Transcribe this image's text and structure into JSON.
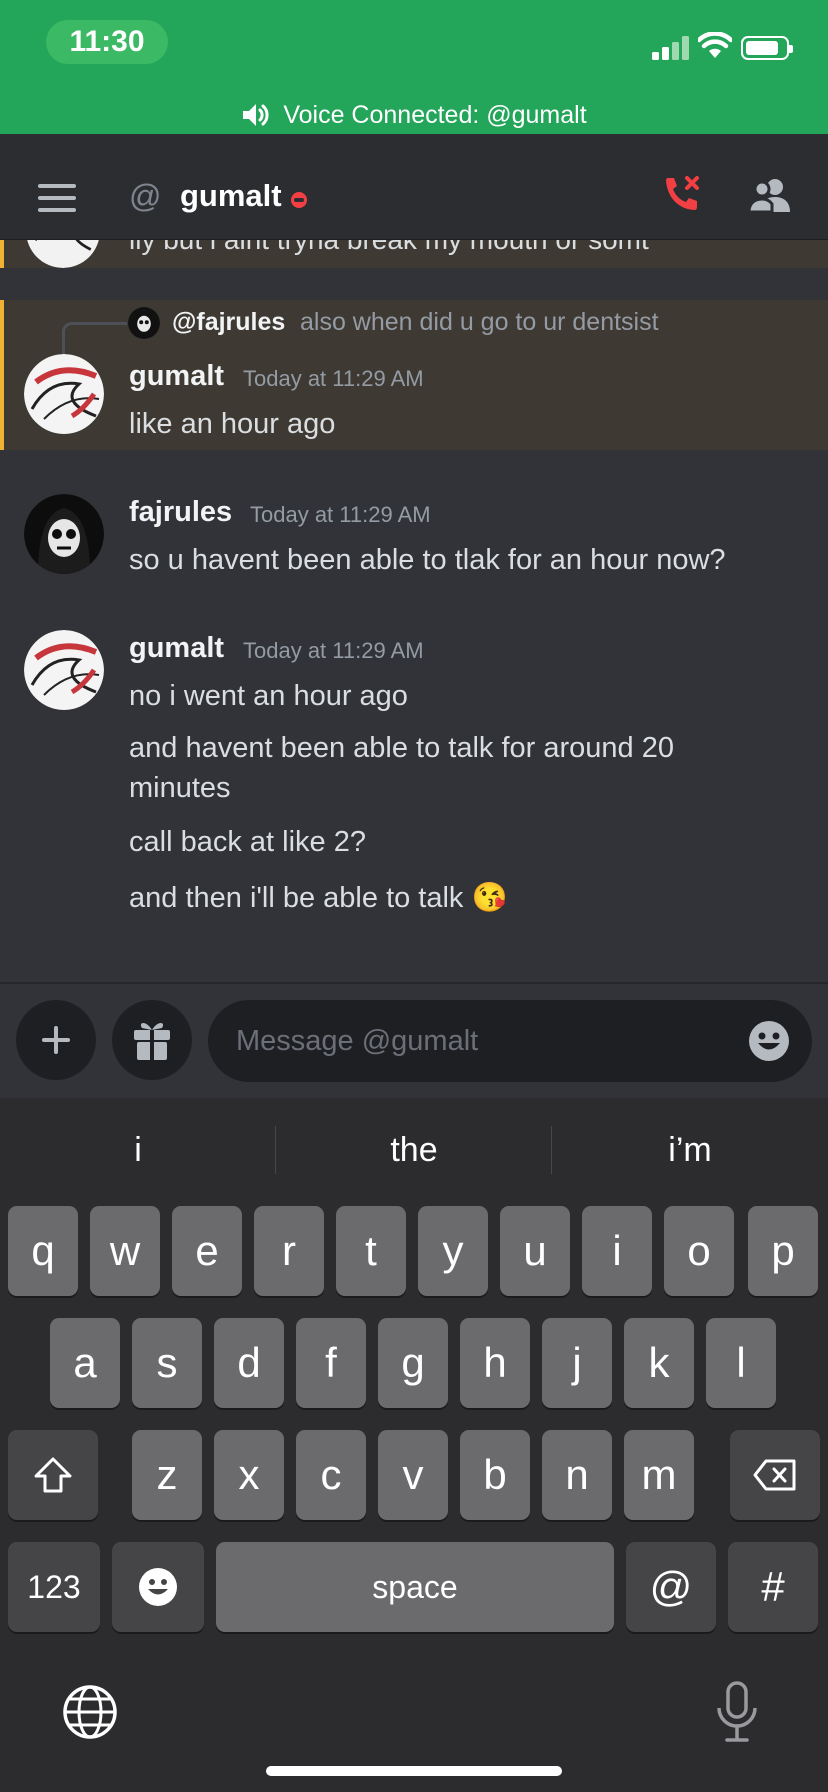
{
  "status_bar": {
    "time": "11:30"
  },
  "voice_banner": {
    "text": "Voice Connected: @gumalt"
  },
  "header": {
    "at_symbol": "@",
    "name": "gumalt",
    "status": "dnd"
  },
  "chat": {
    "previous_partial": "ily but i aint tryna break my mouth or somt",
    "messages": [
      {
        "author": "gumalt",
        "timestamp": "Today at 11:29 AM",
        "highlighted": true,
        "reply": {
          "author": "@fajrules",
          "text": "also when did u go to ur dentsist"
        },
        "lines": [
          "like an hour ago"
        ]
      },
      {
        "author": "fajrules",
        "timestamp": "Today at 11:29 AM",
        "lines": [
          "so u havent been able to tlak for an hour now?"
        ]
      },
      {
        "author": "gumalt",
        "timestamp": "Today at 11:29 AM",
        "lines": [
          "no i went an hour ago",
          "and havent been able to talk for around 20 minutes",
          "call back at like 2?",
          "and then i'll be able to talk 😘"
        ]
      }
    ]
  },
  "composer": {
    "placeholder": "Message @gumalt"
  },
  "keyboard": {
    "suggestions": [
      "i",
      "the",
      "i’m"
    ],
    "row1": [
      "q",
      "w",
      "e",
      "r",
      "t",
      "y",
      "u",
      "i",
      "o",
      "p"
    ],
    "row2": [
      "a",
      "s",
      "d",
      "f",
      "g",
      "h",
      "j",
      "k",
      "l"
    ],
    "row3": [
      "z",
      "x",
      "c",
      "v",
      "b",
      "n",
      "m"
    ],
    "numbers_key": "123",
    "space_key": "space",
    "at_key": "@",
    "hash_key": "#"
  },
  "colors": {
    "voice_green": "#23a55a",
    "mention_highlight": "#3e3a33",
    "mention_bar": "#f0b232",
    "hangup_red": "#f23f43"
  },
  "icons": [
    "speaker-icon",
    "hamburger-icon",
    "at-icon",
    "hang-up-icon",
    "members-icon",
    "plus-icon",
    "gift-icon",
    "emoji-icon",
    "shift-icon",
    "backspace-icon",
    "globe-icon",
    "microphone-icon"
  ]
}
